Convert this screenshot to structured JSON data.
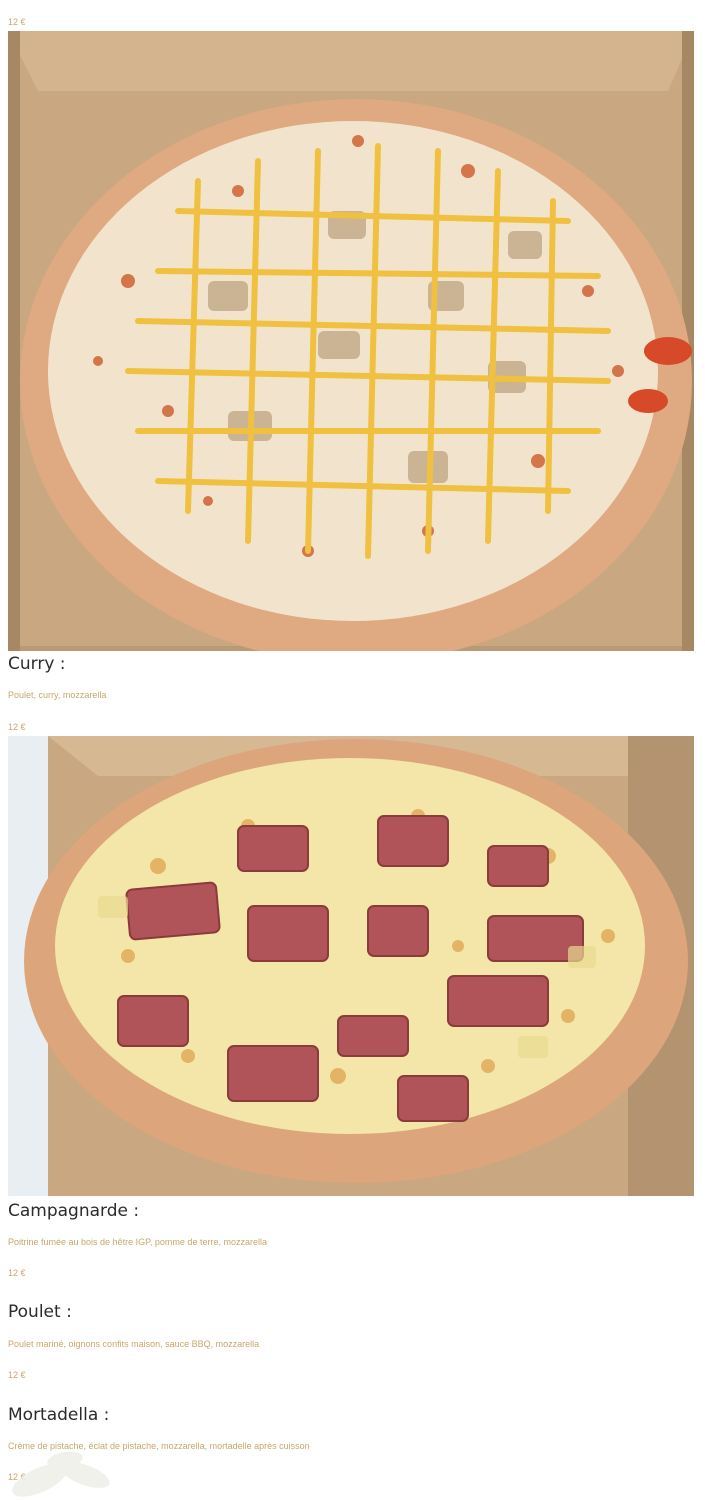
{
  "menu": {
    "items": [
      {
        "price_above": "12 €"
      },
      {
        "name": "Curry :",
        "ingredients": "Poulet, curry, mozzarella",
        "price": "12 €"
      },
      {
        "name": "Campagnarde :",
        "ingredients": "Poitrine fumée au bois de hêtre IGP, pomme de terre, mozzarella",
        "price": "12 €"
      },
      {
        "name": "Poulet :",
        "ingredients": "Poulet mariné, oignons confits maison, sauce BBQ, mozzarella",
        "price": "12 €"
      },
      {
        "name": "Mortadella :",
        "ingredients": "Crème de pistache, éclat de pistache, mozzarella, mortadelle après cuisson",
        "price": "12 €"
      }
    ]
  },
  "colors": {
    "accent_text": "#c9a66b",
    "title_text": "#2b2b2b",
    "box_cardboard": "#c8a781",
    "crust": "#e2b48d"
  },
  "icons": {
    "decorative": "leaf-watermark-icon"
  }
}
